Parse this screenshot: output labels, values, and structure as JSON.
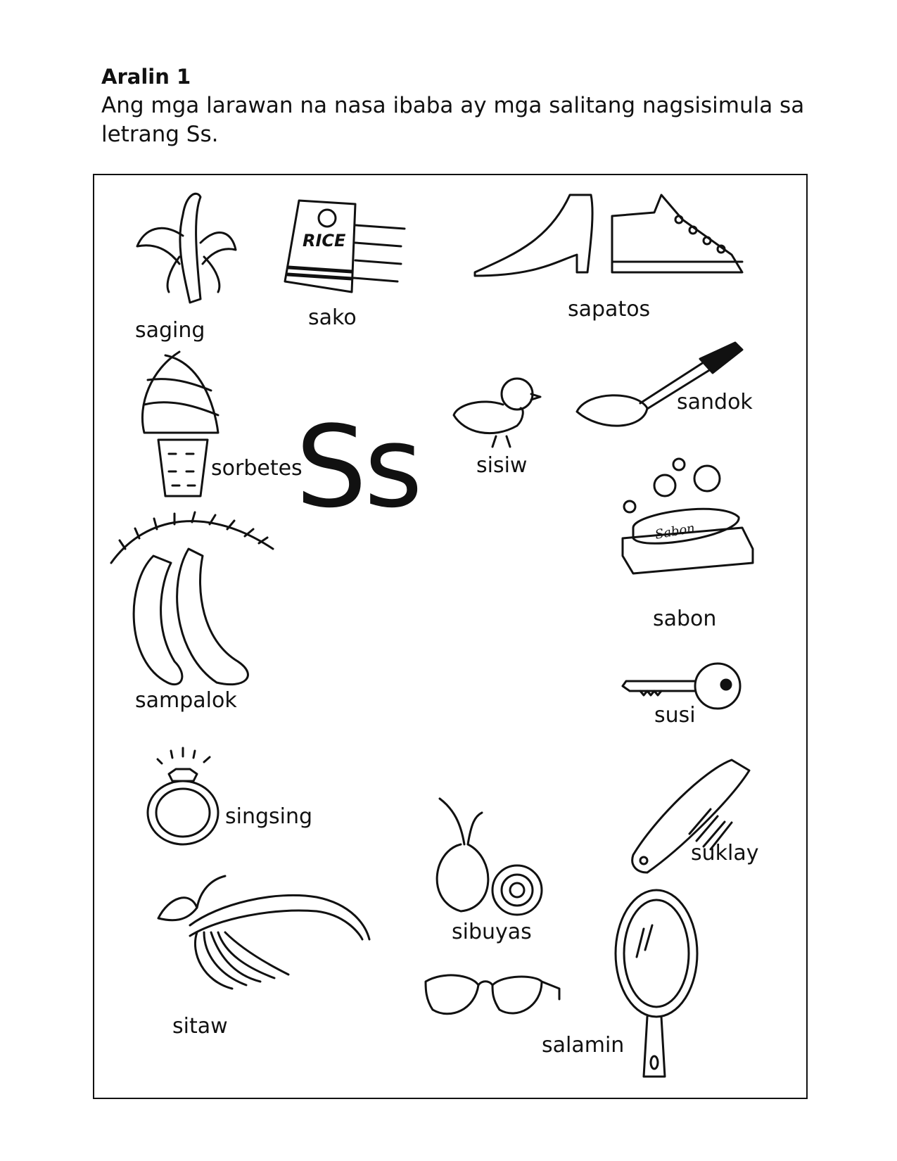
{
  "header": {
    "title": "Aralin 1",
    "instruction": "Ang mga larawan na  nasa ibaba ay mga salitang nagsisimula sa letrang Ss."
  },
  "center_letter": "Ss",
  "items": [
    {
      "word": "saging",
      "icon": "banana-icon"
    },
    {
      "word": "sako",
      "icon": "rice-sack-icon",
      "icon_text": "RICE"
    },
    {
      "word": "sapatos",
      "icon": "shoes-icon"
    },
    {
      "word": "sorbetes",
      "icon": "ice-cream-icon"
    },
    {
      "word": "sisiw",
      "icon": "chick-icon"
    },
    {
      "word": "sandok",
      "icon": "ladle-icon"
    },
    {
      "word": "sampalok",
      "icon": "tamarind-icon"
    },
    {
      "word": "sabon",
      "icon": "soap-icon",
      "icon_text": "Sabon"
    },
    {
      "word": "susi",
      "icon": "key-icon"
    },
    {
      "word": "singsing",
      "icon": "ring-icon"
    },
    {
      "word": "suklay",
      "icon": "comb-icon"
    },
    {
      "word": "sibuyas",
      "icon": "onion-icon"
    },
    {
      "word": "sitaw",
      "icon": "string-beans-icon"
    },
    {
      "word": "salamin",
      "icon": "eyeglasses-icon"
    },
    {
      "word": "salamin",
      "icon": "hand-mirror-icon"
    }
  ]
}
